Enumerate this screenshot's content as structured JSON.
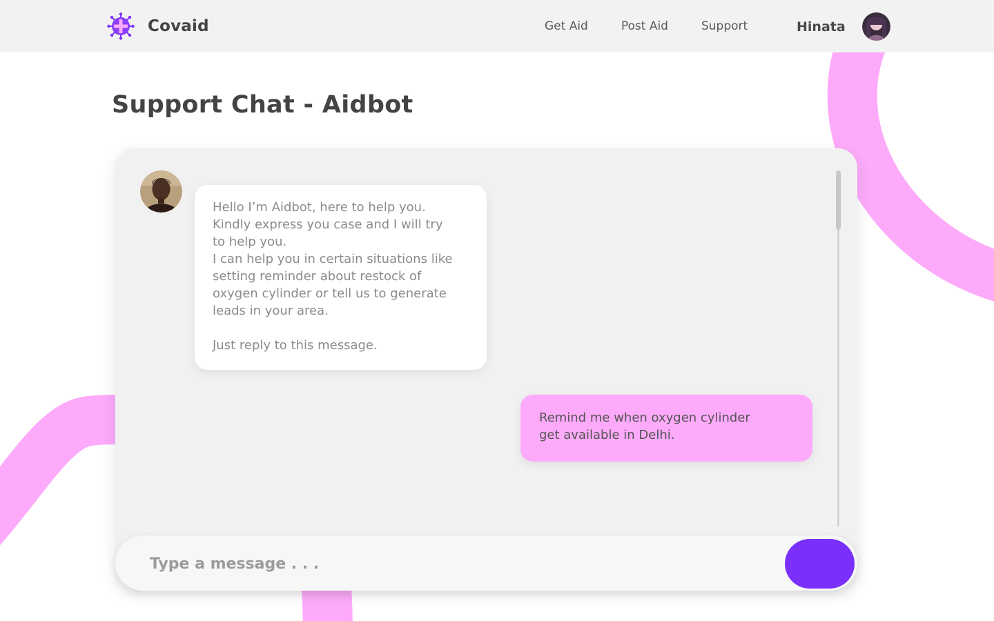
{
  "header": {
    "brand_name": "Covaid",
    "nav": [
      "Get Aid",
      "Post Aid",
      "Support"
    ],
    "user_name": "Hinata"
  },
  "page": {
    "title": "Support Chat - Aidbot"
  },
  "chat": {
    "messages": [
      {
        "sender": "bot",
        "paragraphs": [
          "Hello I’m Aidbot, here to help you.",
          "Kindly express you case and I will try",
          "to help you.",
          "I can help you in certain situations like",
          "setting reminder about restock of",
          "oxygen cylinder or tell us to generate",
          "leads in your area.",
          "Just reply to this message."
        ]
      },
      {
        "sender": "user",
        "lines": [
          "Remind me when oxygen cylinder",
          "get available in Delhi."
        ]
      }
    ]
  },
  "composer": {
    "placeholder": "Type a message . . .",
    "send_icon": "send-icon"
  },
  "colors": {
    "accent": "#7a2ffa",
    "user_bubble": "#fcaaf9",
    "decoration": "#fcaaf9",
    "header_bg": "#f2f2f2",
    "card_bg": "#f1f1f1"
  }
}
